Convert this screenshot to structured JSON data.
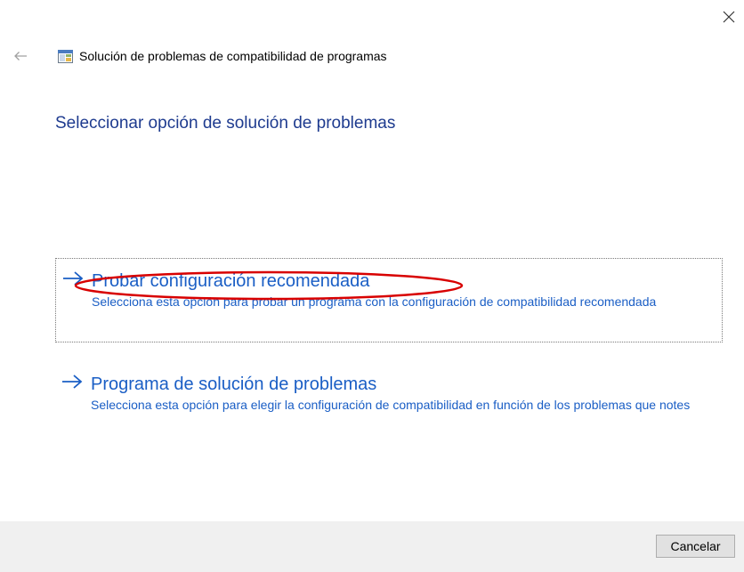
{
  "window": {
    "title": "Solución de problemas de compatibilidad de programas",
    "app_icon": "program-compatibility-icon",
    "back_icon": "back-arrow-icon",
    "close_icon": "close-icon"
  },
  "main": {
    "heading": "Seleccionar opción de solución de problemas",
    "options": [
      {
        "title": "Probar configuración recomendada",
        "description": "Selecciona esta opción para probar un programa con la configuración de compatibilidad recomendada",
        "icon": "right-arrow-icon",
        "focused": true,
        "annotated": true
      },
      {
        "title": "Programa de solución de problemas",
        "description": "Selecciona esta opción para elegir la configuración de compatibilidad en función de los problemas que notes",
        "icon": "right-arrow-icon",
        "focused": false,
        "annotated": false
      }
    ]
  },
  "footer": {
    "cancel_label": "Cancelar"
  },
  "colors": {
    "heading": "#1e3b8f",
    "link": "#1a5ec5",
    "annotation": "#d80000",
    "footer_bg": "#f0f0f0"
  }
}
